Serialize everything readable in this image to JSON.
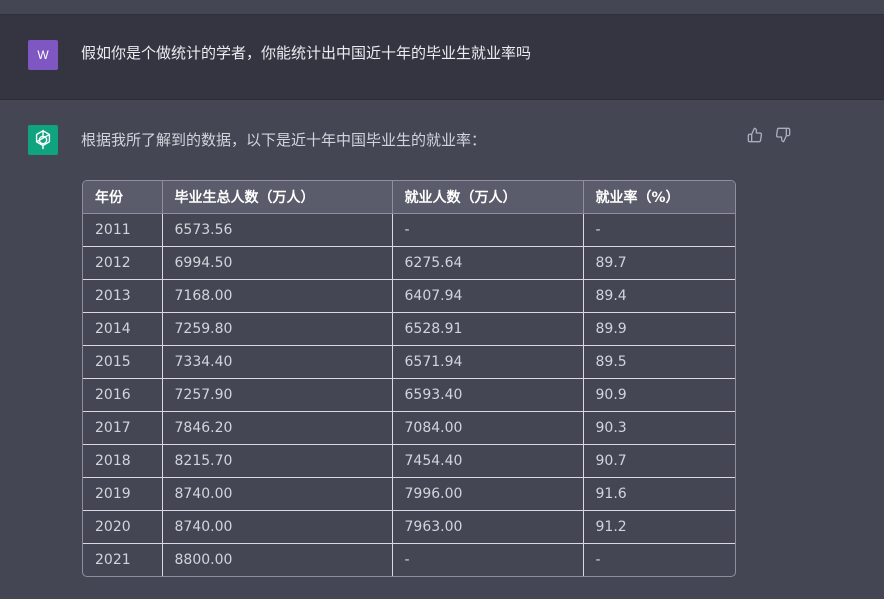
{
  "user": {
    "avatar_letter": "W",
    "message": "假如你是个做统计的学者，你能统计出中国近十年的毕业生就业率吗"
  },
  "assistant": {
    "intro": "根据我所了解到的数据，以下是近十年中国毕业生的就业率：",
    "table": {
      "headers": [
        "年份",
        "毕业生总人数（万人）",
        "就业人数（万人）",
        "就业率（%）"
      ],
      "rows": [
        [
          "2011",
          "6573.56",
          "-",
          "-"
        ],
        [
          "2012",
          "6994.50",
          "6275.64",
          "89.7"
        ],
        [
          "2013",
          "7168.00",
          "6407.94",
          "89.4"
        ],
        [
          "2014",
          "7259.80",
          "6528.91",
          "89.9"
        ],
        [
          "2015",
          "7334.40",
          "6571.94",
          "89.5"
        ],
        [
          "2016",
          "7257.90",
          "6593.40",
          "90.9"
        ],
        [
          "2017",
          "7846.20",
          "7084.00",
          "90.3"
        ],
        [
          "2018",
          "8215.70",
          "7454.40",
          "90.7"
        ],
        [
          "2019",
          "8740.00",
          "7996.00",
          "91.6"
        ],
        [
          "2020",
          "8740.00",
          "7963.00",
          "91.2"
        ],
        [
          "2021",
          "8800.00",
          "-",
          "-"
        ]
      ]
    }
  },
  "icons": {
    "thumbs_up": "thumbs-up-icon",
    "thumbs_down": "thumbs-down-icon",
    "openai_logo": "openai-logo-icon"
  },
  "colors": {
    "user_avatar": "#7e57c2",
    "assistant_avatar": "#10a37f",
    "user_bg": "#343541",
    "assistant_bg": "#444654"
  }
}
